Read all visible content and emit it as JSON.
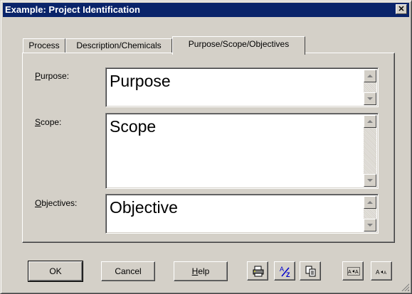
{
  "window": {
    "title": "Example: Project Identification",
    "close_label": "✕"
  },
  "tabs": [
    {
      "label": "Process"
    },
    {
      "label": "Description/Chemicals"
    },
    {
      "label": "Purpose/Scope/Objectives",
      "selected": true
    }
  ],
  "fields": {
    "purpose": {
      "label_key": "P",
      "label_rest": "urpose:",
      "value": "Purpose"
    },
    "scope": {
      "label_key": "S",
      "label_rest": "cope:",
      "value": "Scope"
    },
    "objectives": {
      "label_key": "O",
      "label_rest": "bjectives:",
      "value": "Objective"
    }
  },
  "buttons": {
    "ok": "OK",
    "cancel": "Cancel",
    "help_key": "H",
    "help_rest": "elp"
  },
  "toolbar_icons": [
    "print-icon",
    "spellcheck-icon",
    "copy-icon",
    "expand-text-icon",
    "shrink-text-icon"
  ],
  "colors": {
    "titlebar": "#0a246a",
    "dialog_face": "#d4d0c8",
    "text_field": "#ffffff",
    "spell_icon_accent": "#0000cc"
  }
}
